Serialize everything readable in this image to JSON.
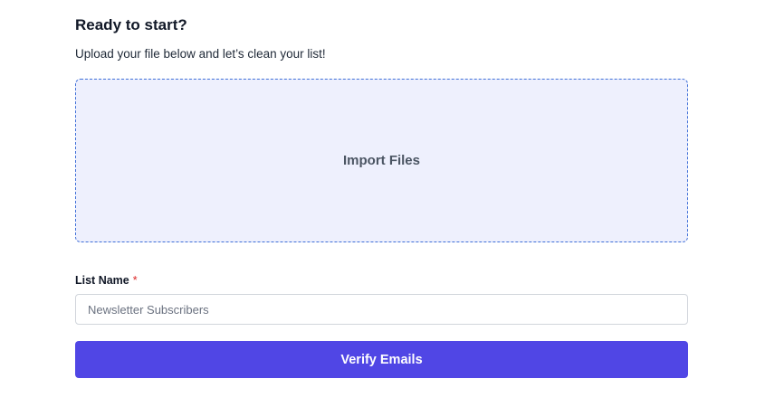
{
  "header": {
    "title": "Ready to start?",
    "subtitle": "Upload your file below and let’s clean your list!"
  },
  "upload": {
    "label": "Import Files"
  },
  "list_name": {
    "label": "List Name",
    "required_marker": "*",
    "value": "",
    "placeholder": "Newsletter Subscribers"
  },
  "actions": {
    "verify_label": "Verify Emails"
  },
  "colors": {
    "accent": "#5046e5",
    "dropzone_border": "#3f6fd8",
    "dropzone_bg": "#eef0fd",
    "required": "#dc2626"
  }
}
